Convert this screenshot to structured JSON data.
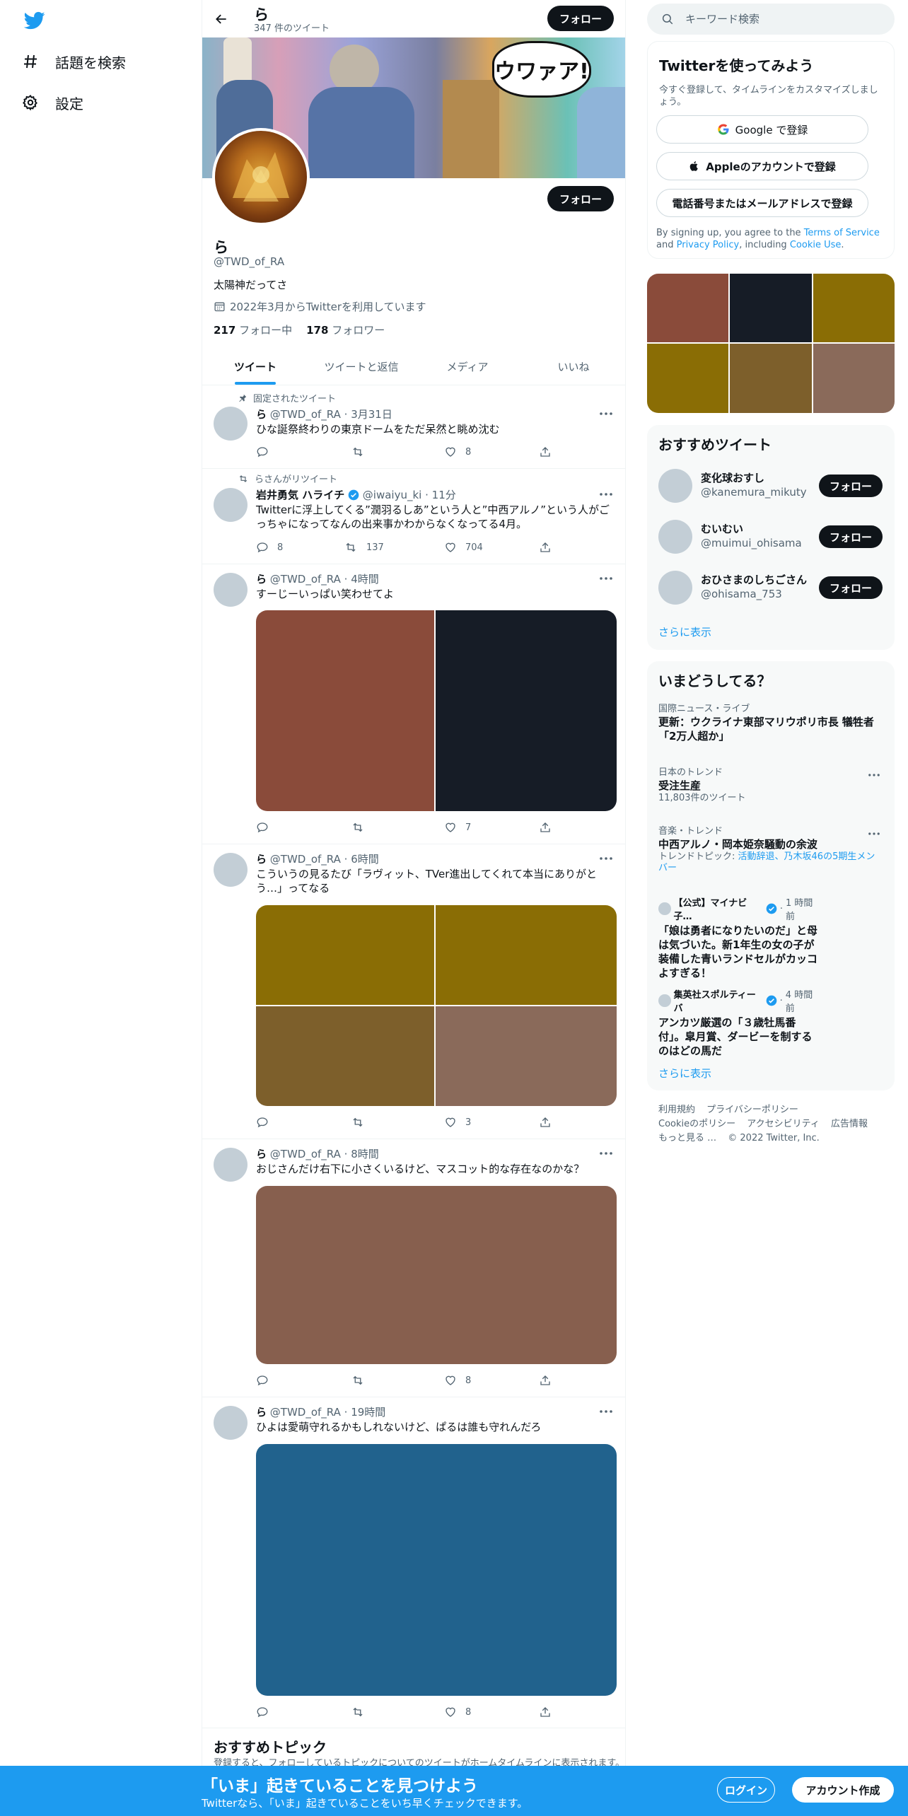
{
  "nav": {
    "logo": "twitter-bird-icon",
    "items": [
      {
        "label": "話題を検索",
        "icon": "hash-icon"
      },
      {
        "label": "設定",
        "icon": "gear-icon"
      }
    ]
  },
  "header": {
    "name": "ら",
    "tweet_count": "347 件のツイート",
    "follow_label": "フォロー"
  },
  "profile": {
    "name": "ら",
    "handle": "@TWD_of_RA",
    "bio": "太陽神だってさ",
    "joined": "2022年3月からTwitterを利用しています",
    "following_count": "217",
    "following_label": "フォロー中",
    "followers_count": "178",
    "followers_label": "フォロワー",
    "follow_label": "フォロー",
    "banner_text": "ウワァア!"
  },
  "tabs": [
    "ツイート",
    "ツイートと返信",
    "メディア",
    "いいね"
  ],
  "tweets": [
    {
      "social": "固定されたツイート",
      "name": "ら",
      "handle": "@TWD_of_RA",
      "time": "3月31日",
      "text": "ひな誕祭終わりの東京ドームをただ呆然と眺め沈む",
      "replies": "",
      "retweets": "",
      "likes": "8"
    },
    {
      "social": "らさんがリツイート",
      "name": "岩井勇気 ハライチ",
      "handle": "@iwaiyu_ki",
      "time": "11分",
      "text": "Twitterに浮上してくる”潤羽るしあ”という人と”中西アルノ”という人がごっちゃになってなんの出来事かわからなくなってる4月。",
      "replies": "8",
      "retweets": "137",
      "likes": "704"
    },
    {
      "name": "ら",
      "handle": "@TWD_of_RA",
      "time": "4時間",
      "text": "すーじーいっぱい笑わせてよ",
      "replies": "",
      "retweets": "",
      "likes": "7",
      "media_colors": [
        "#8a4b3a",
        "#161c26"
      ]
    },
    {
      "name": "ら",
      "handle": "@TWD_of_RA",
      "time": "6時間",
      "text": "こういうの見るたび「ラヴィット、TVer進出してくれて本当にありがとう…」ってなる",
      "replies": "",
      "retweets": "",
      "likes": "3",
      "media_colors": [
        "#8a6d05",
        "#8a6d05",
        "#7d5f2b",
        "#8a6a5a"
      ]
    },
    {
      "name": "ら",
      "handle": "@TWD_of_RA",
      "time": "8時間",
      "text": "おじさんだけ右下に小さくいるけど、マスコット的な存在なのかな？",
      "replies": "",
      "retweets": "",
      "likes": "8",
      "media_colors": [
        "#875f4e"
      ]
    },
    {
      "name": "ら",
      "handle": "@TWD_of_RA",
      "time": "19時間",
      "text": "ひよは愛萌守れるかもしれないけど、ぱるは誰も守れんだろ",
      "replies": "",
      "retweets": "",
      "likes": "8",
      "media_colors": [
        "#21628d"
      ]
    }
  ],
  "recommended_topics": {
    "title": "おすすめトピック",
    "subtitle": "登録すると、フォローしているトピックについてのツイートがホームタイムラインに表示されます。"
  },
  "search": {
    "placeholder": "キーワード検索"
  },
  "signup_card": {
    "title": "Twitterを使ってみよう",
    "subtitle": "今すぐ登録して、タイムラインをカスタマイズしましょう。",
    "google": "Google で登録",
    "apple": "Appleのアカウントで登録",
    "phone": "電話番号またはメールアドレスで登録",
    "terms_prefix": "By signing up, you agree to the",
    "terms_link": "Terms of Service",
    "terms_and": "and",
    "privacy_link": "Privacy Policy",
    "terms_including": ", including",
    "cookie_link": "Cookie Use",
    "terms_end": "."
  },
  "media_grid_colors": [
    "#8a4b3a",
    "#161c26",
    "#8a6d05",
    "#8a6d05",
    "#7d5f2b",
    "#8a6a5a"
  ],
  "who_to_follow": {
    "title": "おすすめツイート",
    "follow_label": "フォロー",
    "show_more": "さらに表示",
    "users": [
      {
        "name": "変化球おすし",
        "handle": "@kanemura_mikuty"
      },
      {
        "name": "むいむい",
        "handle": "@muimui_ohisama"
      },
      {
        "name": "おひさまのしちごさん",
        "handle": "@ohisama_753"
      }
    ]
  },
  "trends": {
    "title": "いまどうしてる？",
    "show_more": "さらに表示",
    "items": [
      {
        "category": "国際ニュース・ライブ",
        "title": "更新：ウクライナ東部マリウポリ市長 犠牲者「2万人超か」"
      },
      {
        "category": "日本のトレンド",
        "title": "受注生産",
        "sub": "11,803件のツイート"
      },
      {
        "category": "音楽・トレンド",
        "title": "中西アルノ・岡本姫奈騒動の余波",
        "sub_prefix": "トレンドトピック:",
        "sub_link": "活動辞退、乃木坂46の5期生メンバー"
      }
    ],
    "news": [
      {
        "source": "【公式】マイナビ子…",
        "time": "1 時間前",
        "title": "「娘は勇者になりたいのだ」と母は気づいた。新1年生の女の子が装備した青いランドセルがカッコよすぎる！"
      },
      {
        "source": "集英社スポルティーバ",
        "time": "4 時間前",
        "title": "アンカツ厳選の「３歳牡馬番付」。皐月賞、ダービーを制するのはどの馬だ"
      }
    ]
  },
  "footer": {
    "links": [
      "利用規約",
      "プライバシーポリシー",
      "Cookieのポリシー",
      "アクセシビリティ",
      "広告情報",
      "もっと見る …"
    ],
    "copyright": "© 2022 Twitter, Inc."
  },
  "bottom_bar": {
    "title": "「いま」起きていることを見つけよう",
    "subtitle": "Twitterなら、「いま」起きていることをいち早くチェックできます。",
    "login": "ログイン",
    "signup": "アカウント作成"
  },
  "colors": {
    "accent": "#1d9bf0",
    "text": "#0f1419",
    "muted": "#536471",
    "bottom_bar": "#1d9bf0"
  }
}
